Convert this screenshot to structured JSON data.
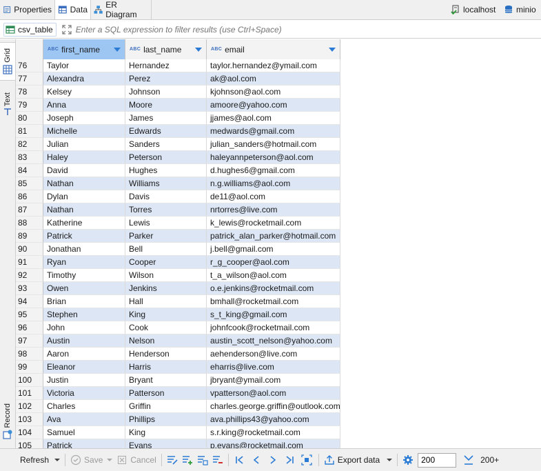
{
  "tabs": [
    {
      "label": "Properties",
      "icon": "properties-icon"
    },
    {
      "label": "Data",
      "icon": "data-table-icon"
    },
    {
      "label": "ER Diagram",
      "icon": "er-diagram-icon"
    }
  ],
  "connection": {
    "host": "localhost",
    "database": "minio"
  },
  "filter": {
    "table_name": "csv_table",
    "placeholder": "Enter a SQL expression to filter results (use Ctrl+Space)"
  },
  "side_tabs": {
    "grid": "Grid",
    "text": "Text",
    "record": "Record"
  },
  "columns": [
    {
      "name": "first_name",
      "type_badge": "ABC"
    },
    {
      "name": "last_name",
      "type_badge": "ABC"
    },
    {
      "name": "email",
      "type_badge": "ABC"
    }
  ],
  "rows": [
    {
      "n": "76",
      "first": "Taylor",
      "last": "Hernandez",
      "email": "taylor.hernandez@ymail.com"
    },
    {
      "n": "77",
      "first": "Alexandra",
      "last": "Perez",
      "email": "ak@aol.com"
    },
    {
      "n": "78",
      "first": "Kelsey",
      "last": "Johnson",
      "email": "kjohnson@aol.com"
    },
    {
      "n": "79",
      "first": "Anna",
      "last": "Moore",
      "email": "amoore@yahoo.com"
    },
    {
      "n": "80",
      "first": "Joseph",
      "last": "James",
      "email": "jjames@aol.com"
    },
    {
      "n": "81",
      "first": "Michelle",
      "last": "Edwards",
      "email": "medwards@gmail.com"
    },
    {
      "n": "82",
      "first": "Julian",
      "last": "Sanders",
      "email": "julian_sanders@hotmail.com"
    },
    {
      "n": "83",
      "first": "Haley",
      "last": "Peterson",
      "email": "haleyannpeterson@aol.com"
    },
    {
      "n": "84",
      "first": "David",
      "last": "Hughes",
      "email": "d.hughes6@gmail.com"
    },
    {
      "n": "85",
      "first": "Nathan",
      "last": "Williams",
      "email": "n.g.williams@aol.com"
    },
    {
      "n": "86",
      "first": "Dylan",
      "last": "Davis",
      "email": "de11@aol.com"
    },
    {
      "n": "87",
      "first": "Nathan",
      "last": "Torres",
      "email": "nrtorres@live.com"
    },
    {
      "n": "88",
      "first": "Katherine",
      "last": "Lewis",
      "email": "k_lewis@rocketmail.com"
    },
    {
      "n": "89",
      "first": "Patrick",
      "last": "Parker",
      "email": "patrick_alan_parker@hotmail.com"
    },
    {
      "n": "90",
      "first": "Jonathan",
      "last": "Bell",
      "email": "j.bell@gmail.com"
    },
    {
      "n": "91",
      "first": "Ryan",
      "last": "Cooper",
      "email": "r_g_cooper@aol.com"
    },
    {
      "n": "92",
      "first": "Timothy",
      "last": "Wilson",
      "email": "t_a_wilson@aol.com"
    },
    {
      "n": "93",
      "first": "Owen",
      "last": "Jenkins",
      "email": "o.e.jenkins@rocketmail.com"
    },
    {
      "n": "94",
      "first": "Brian",
      "last": "Hall",
      "email": "bmhall@rocketmail.com"
    },
    {
      "n": "95",
      "first": "Stephen",
      "last": "King",
      "email": "s_t_king@gmail.com"
    },
    {
      "n": "96",
      "first": "John",
      "last": "Cook",
      "email": "johnfcook@rocketmail.com"
    },
    {
      "n": "97",
      "first": "Austin",
      "last": "Nelson",
      "email": "austin_scott_nelson@yahoo.com"
    },
    {
      "n": "98",
      "first": "Aaron",
      "last": "Henderson",
      "email": "aehenderson@live.com"
    },
    {
      "n": "99",
      "first": "Eleanor",
      "last": "Harris",
      "email": "eharris@live.com"
    },
    {
      "n": "100",
      "first": "Justin",
      "last": "Bryant",
      "email": "jbryant@ymail.com"
    },
    {
      "n": "101",
      "first": "Victoria",
      "last": "Patterson",
      "email": "vpatterson@aol.com"
    },
    {
      "n": "102",
      "first": "Charles",
      "last": "Griffin",
      "email": "charles.george.griffin@outlook.com"
    },
    {
      "n": "103",
      "first": "Ava",
      "last": "Phillips",
      "email": "ava.phillips43@yahoo.com"
    },
    {
      "n": "104",
      "first": "Samuel",
      "last": "King",
      "email": "s.r.king@rocketmail.com"
    },
    {
      "n": "105",
      "first": "Patrick",
      "last": "Evans",
      "email": "p.evans@rocketmail.com"
    }
  ],
  "toolbar": {
    "refresh": "Refresh",
    "save": "Save",
    "cancel": "Cancel",
    "export": "Export data",
    "fetch_size": "200",
    "fetch_more": "200+"
  },
  "colors": {
    "accent": "#2a7bd6",
    "selected_header": "#9ec6f3",
    "alt_row": "#dce6f4"
  }
}
